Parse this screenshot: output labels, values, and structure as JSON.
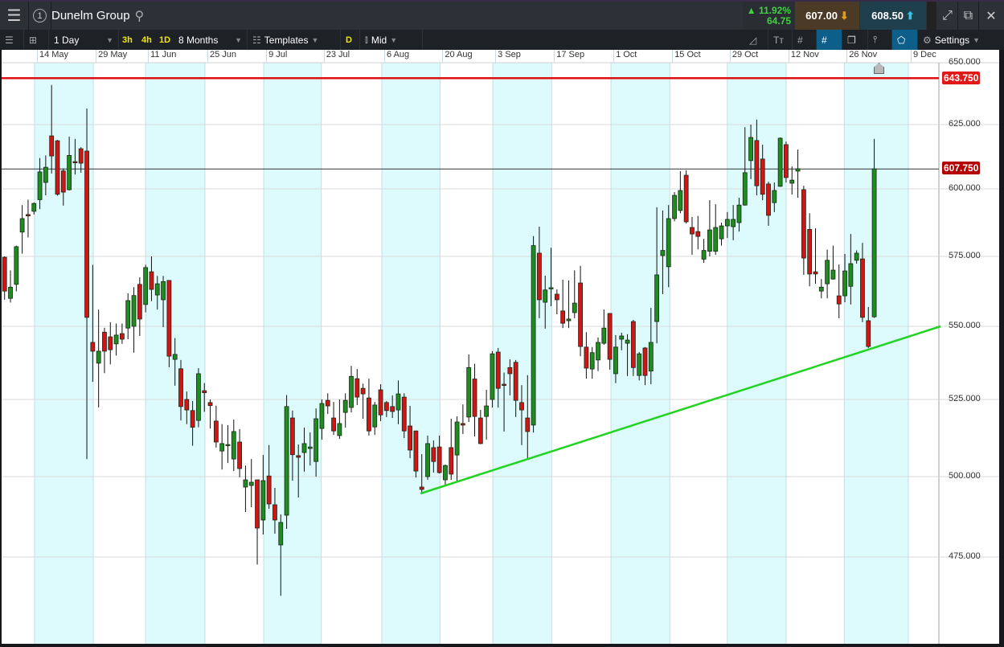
{
  "header": {
    "instrument": "Dunelm Group",
    "change_pct": "11.92%",
    "change_abs": "64.75",
    "sell_price": "607.00",
    "buy_price": "608.50"
  },
  "toolbar": {
    "interval": "1 Day",
    "quick": [
      "3h",
      "4h",
      "1D"
    ],
    "range": "8 Months",
    "templates": "Templates",
    "d_label": "D",
    "price_type": "Mid",
    "settings": "Settings"
  },
  "colors": {
    "up": "#1e8c1e",
    "down": "#d11414",
    "support": "#22d422",
    "resistance": "#dd1111",
    "band": "#ddfbfd"
  },
  "chart_data": {
    "type": "candlestick",
    "title": "Dunelm Group",
    "ylim": [
      462,
      652
    ],
    "y_ticks": [
      "650.000",
      "625.000",
      "600.000",
      "575.000",
      "550.000",
      "525.000",
      "500.000",
      "475.000"
    ],
    "y_tick_values": [
      650,
      625,
      600,
      575,
      550,
      525,
      500,
      475
    ],
    "x_ticks": [
      {
        "label": "14 May",
        "bar": 5.1
      },
      {
        "label": "29 May",
        "bar": 15.1
      },
      {
        "label": "11 Jun",
        "bar": 24
      },
      {
        "label": "25 Jun",
        "bar": 34.1
      },
      {
        "label": "9 Jul",
        "bar": 44.1
      },
      {
        "label": "23 Jul",
        "bar": 53.9
      },
      {
        "label": "6 Aug",
        "bar": 64.2
      },
      {
        "label": "20 Aug",
        "bar": 74.1
      },
      {
        "label": "3 Sep",
        "bar": 83.1
      },
      {
        "label": "17 Sep",
        "bar": 93.1
      },
      {
        "label": "1 Oct",
        "bar": 103.2
      },
      {
        "label": "15 Oct",
        "bar": 113.2
      },
      {
        "label": "29 Oct",
        "bar": 123
      },
      {
        "label": "12 Nov",
        "bar": 133
      },
      {
        "label": "26 Nov",
        "bar": 142.9
      },
      {
        "label": "9 Dec",
        "bar": 153.8
      }
    ],
    "resistance_level": {
      "value": 643.75,
      "label": "643.750"
    },
    "current_price": {
      "value": 607.75,
      "label": "607.750"
    },
    "trendline": [
      [
        70.8,
        494.75
      ],
      [
        159.3,
        550
      ]
    ],
    "ohlc": [
      [
        574.7,
        575,
        559.5,
        562.6
      ],
      [
        560,
        570,
        558.5,
        564
      ],
      [
        565,
        579,
        562.5,
        578.6
      ],
      [
        584,
        594,
        576,
        589
      ],
      [
        590.5,
        596,
        582,
        590
      ],
      [
        591.7,
        595,
        590.5,
        594.6
      ],
      [
        596,
        612,
        592.5,
        606.6
      ],
      [
        602.5,
        613,
        597.6,
        608.4
      ],
      [
        620.6,
        641,
        606,
        612.8
      ],
      [
        618.7,
        619,
        597.5,
        598
      ],
      [
        607,
        608,
        593.8,
        598.8
      ],
      [
        599.7,
        620.3,
        599.4,
        613
      ],
      [
        610.6,
        619.4,
        605.6,
        610.4
      ],
      [
        615.6,
        616.2,
        606.3,
        610
      ],
      [
        614.7,
        631.5,
        505.7,
        553.2
      ],
      [
        544.5,
        572,
        531,
        541.5
      ],
      [
        537.4,
        556,
        522.4,
        541.5
      ],
      [
        548,
        549.5,
        534,
        541.5
      ],
      [
        546.4,
        551.5,
        537,
        542
      ],
      [
        544,
        551,
        540,
        547
      ],
      [
        547.5,
        551,
        544,
        545.6
      ],
      [
        549.4,
        561.8,
        545.6,
        559.2
      ],
      [
        550,
        564,
        541,
        561
      ],
      [
        565,
        567.5,
        546.7,
        552.6
      ],
      [
        557.8,
        572,
        555,
        571
      ],
      [
        569.5,
        575,
        559,
        563.2
      ],
      [
        561.2,
        568,
        556,
        565.2
      ],
      [
        559.5,
        568,
        549.7,
        566
      ],
      [
        566.4,
        566.5,
        536,
        539.8
      ],
      [
        538.7,
        546,
        529.7,
        540.4
      ],
      [
        535.5,
        538.5,
        518.2,
        522.7
      ],
      [
        525,
        527.7,
        517,
        521.6
      ],
      [
        521.4,
        524.5,
        510,
        516
      ],
      [
        518.2,
        535.7,
        516,
        533.8
      ],
      [
        528,
        530.6,
        521,
        527.3
      ],
      [
        524,
        525,
        515.6,
        523
      ],
      [
        518,
        523,
        509.4,
        511.2
      ],
      [
        508.3,
        517,
        502.3,
        510.7
      ],
      [
        510.4,
        516.7,
        504.4,
        510.4
      ],
      [
        505.7,
        518.5,
        501.8,
        514.6
      ],
      [
        511.2,
        515.4,
        499.8,
        502.6
      ],
      [
        496.75,
        503.6,
        489,
        499
      ],
      [
        497.25,
        505.7,
        490.5,
        498.25
      ],
      [
        499,
        499,
        472.75,
        484
      ],
      [
        486.5,
        507,
        482,
        498.75
      ],
      [
        500.2,
        510.2,
        490,
        491.5
      ],
      [
        491.25,
        496.5,
        482.25,
        486.5
      ],
      [
        478.75,
        488.25,
        463.5,
        485.75
      ],
      [
        488,
        526.5,
        483.75,
        522.7
      ],
      [
        519,
        521.4,
        498.75,
        507.1
      ],
      [
        506.8,
        510.4,
        493.5,
        506.25
      ],
      [
        507.8,
        515.9,
        501.6,
        510.7
      ],
      [
        509.1,
        514.3,
        503.6,
        509.6
      ],
      [
        504.9,
        522.1,
        500,
        518.75
      ],
      [
        515.6,
        525,
        512,
        523.7
      ],
      [
        524.7,
        527.1,
        520.3,
        522.9
      ],
      [
        519,
        524.2,
        513.5,
        514.8
      ],
      [
        513.3,
        525,
        512.2,
        517.2
      ],
      [
        520.8,
        527.1,
        515.9,
        524.7
      ],
      [
        522.4,
        536.5,
        520.8,
        532.9
      ],
      [
        532.1,
        535.4,
        523.2,
        525.8
      ],
      [
        528.8,
        530.4,
        518.75,
        526.9
      ],
      [
        525.5,
        532.1,
        513.3,
        514.8
      ],
      [
        516.1,
        524.2,
        513.5,
        523.2
      ],
      [
        528.3,
        530.2,
        518,
        520
      ],
      [
        524,
        524.5,
        519.3,
        521.4
      ],
      [
        522.7,
        526.4,
        519,
        521.1
      ],
      [
        521.6,
        531.5,
        517,
        526.9
      ],
      [
        525.8,
        527.1,
        512.5,
        514.8
      ],
      [
        516.4,
        522.9,
        506,
        508.6
      ],
      [
        514.8,
        514.9,
        499.75,
        501.8
      ],
      [
        496.75,
        507.3,
        494.5,
        496
      ],
      [
        500,
        513.3,
        499,
        510.7
      ],
      [
        509.4,
        511.7,
        501.3,
        504.9
      ],
      [
        509.6,
        513.3,
        501,
        501.3
      ],
      [
        499,
        503.9,
        497,
        503.6
      ],
      [
        509.4,
        518.75,
        499,
        500.8
      ],
      [
        507,
        519.5,
        498.25,
        517.7
      ],
      [
        517.2,
        523.4,
        513.8,
        516.7
      ],
      [
        519.3,
        540.4,
        517.7,
        535.9
      ],
      [
        532,
        537.2,
        513,
        519.5
      ],
      [
        519,
        521.6,
        510.5,
        510.7
      ],
      [
        519.5,
        528.3,
        512,
        522.9
      ],
      [
        525,
        541.5,
        522.4,
        540.6
      ],
      [
        541.2,
        542.6,
        522.4,
        528.8
      ],
      [
        530.2,
        534.2,
        514.6,
        530
      ],
      [
        535.9,
        538.7,
        526.4,
        533.8
      ],
      [
        537.7,
        538.5,
        519.3,
        524.7
      ],
      [
        524,
        529.9,
        510.2,
        521.6
      ],
      [
        519,
        533.3,
        505.7,
        514.6
      ],
      [
        516.7,
        582.5,
        514.3,
        579
      ],
      [
        576.2,
        586,
        552.9,
        559.5
      ],
      [
        558.6,
        568.1,
        549.2,
        563
      ],
      [
        563.8,
        578.2,
        557.2,
        563.8
      ],
      [
        561.5,
        563.2,
        554.3,
        559.5
      ],
      [
        555.5,
        566.7,
        549.4,
        551.1
      ],
      [
        552,
        566.4,
        549.4,
        552.6
      ],
      [
        554.9,
        570,
        552.9,
        558.3
      ],
      [
        565.5,
        571.6,
        539.8,
        543.1
      ],
      [
        542.9,
        548,
        532.1,
        535.7
      ],
      [
        535.4,
        542.9,
        532.1,
        541
      ],
      [
        538.5,
        546.2,
        534.7,
        544.5
      ],
      [
        544.2,
        556,
        543.7,
        549.4
      ],
      [
        554.6,
        554.7,
        535.2,
        538.7
      ],
      [
        533.8,
        547,
        530.6,
        542.9
      ],
      [
        545.6,
        547.8,
        541.8,
        546.7
      ],
      [
        544.2,
        547.3,
        533,
        545.3
      ],
      [
        551.7,
        552.3,
        533,
        535.9
      ],
      [
        533.2,
        541.2,
        531.5,
        540.6
      ],
      [
        542.6,
        542.9,
        529.9,
        533.2
      ],
      [
        534.7,
        556.6,
        530.2,
        544.5
      ],
      [
        551.7,
        593.2,
        544.2,
        568.4
      ],
      [
        575.3,
        592,
        561.5,
        577.2
      ],
      [
        571.3,
        594,
        564,
        589
      ],
      [
        589,
        598.8,
        588,
        597.6
      ],
      [
        592,
        606.9,
        591,
        599.4
      ],
      [
        605.3,
        607.2,
        587.2,
        587.8
      ],
      [
        585.7,
        589.6,
        575.6,
        583.3
      ],
      [
        584.2,
        590,
        577.6,
        582.4
      ],
      [
        574,
        581.5,
        572.7,
        577.2
      ],
      [
        576.9,
        595.8,
        575,
        584.8
      ],
      [
        576.9,
        594.3,
        575.6,
        585.7
      ],
      [
        581.5,
        587.5,
        579,
        586.3
      ],
      [
        586.3,
        591.4,
        581.8,
        588.7
      ],
      [
        586,
        594,
        581,
        588.7
      ],
      [
        587.5,
        596.7,
        584.2,
        594
      ],
      [
        594,
        624,
        593.8,
        606.3
      ],
      [
        611,
        625,
        603.8,
        620
      ],
      [
        618.8,
        627,
        597.6,
        601.2
      ],
      [
        611.6,
        617.2,
        595.8,
        598
      ],
      [
        601.9,
        602.8,
        586.3,
        590.2
      ],
      [
        594.9,
        602.5,
        591.4,
        599.4
      ],
      [
        601,
        620,
        600.8,
        619.7
      ],
      [
        617.2,
        618.4,
        602.5,
        604.4
      ],
      [
        602.2,
        608.7,
        597.9,
        603.4
      ],
      [
        606.9,
        615.3,
        596.7,
        607.8
      ],
      [
        599.7,
        601.2,
        568.4,
        574.4
      ],
      [
        585,
        591,
        564.3,
        568.7
      ],
      [
        569.5,
        585.4,
        565.2,
        568.7
      ],
      [
        562.6,
        566.9,
        560,
        564
      ],
      [
        565.2,
        577.5,
        560,
        573.6
      ],
      [
        566.9,
        579,
        566.7,
        570.1
      ],
      [
        560.9,
        572.1,
        552.9,
        558
      ],
      [
        560.9,
        575.9,
        558.6,
        569.8
      ],
      [
        564.3,
        583.3,
        557.8,
        572.4
      ],
      [
        573.6,
        577.2,
        572.4,
        576.2
      ],
      [
        574.1,
        580,
        551.5,
        553.2
      ],
      [
        552,
        556.9,
        542.6,
        543.1
      ],
      [
        553.4,
        619.4,
        553,
        607.75
      ]
    ]
  }
}
